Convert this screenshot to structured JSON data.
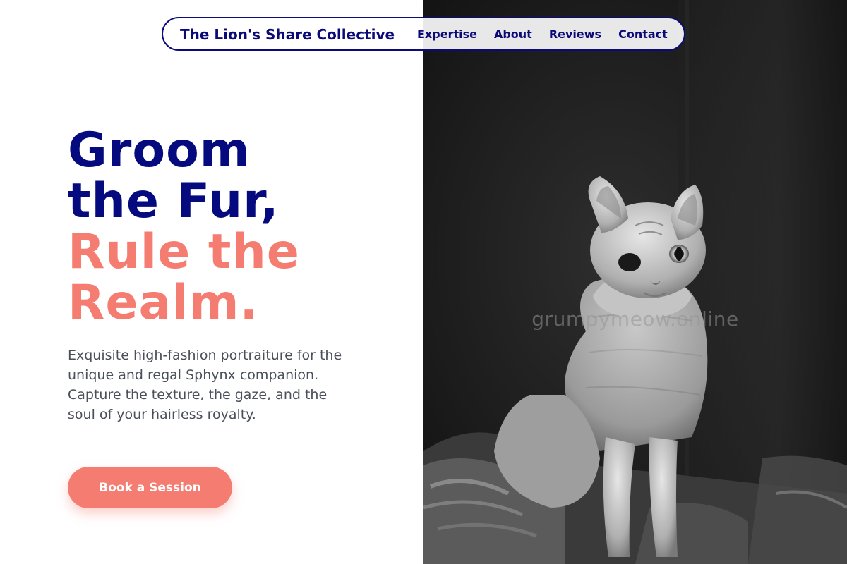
{
  "nav": {
    "brand": "The Lion's Share Collective",
    "links": [
      {
        "label": "Expertise"
      },
      {
        "label": "About"
      },
      {
        "label": "Reviews"
      },
      {
        "label": "Contact"
      }
    ]
  },
  "hero": {
    "headline_line1": "Groom",
    "headline_line2": "the Fur,",
    "headline_line3": "Rule the",
    "headline_line4": "Realm.",
    "description": "Exquisite high-fashion portraiture for the unique and regal Sphynx companion. Capture the texture, the gaze, and the soul of your hairless royalty.",
    "cta_label": "Book a Session"
  },
  "photo": {
    "watermark": "grumpymeow.online"
  },
  "colors": {
    "navy": "#050a7e",
    "coral": "#f57c70",
    "body_text": "#4a4f5a"
  }
}
